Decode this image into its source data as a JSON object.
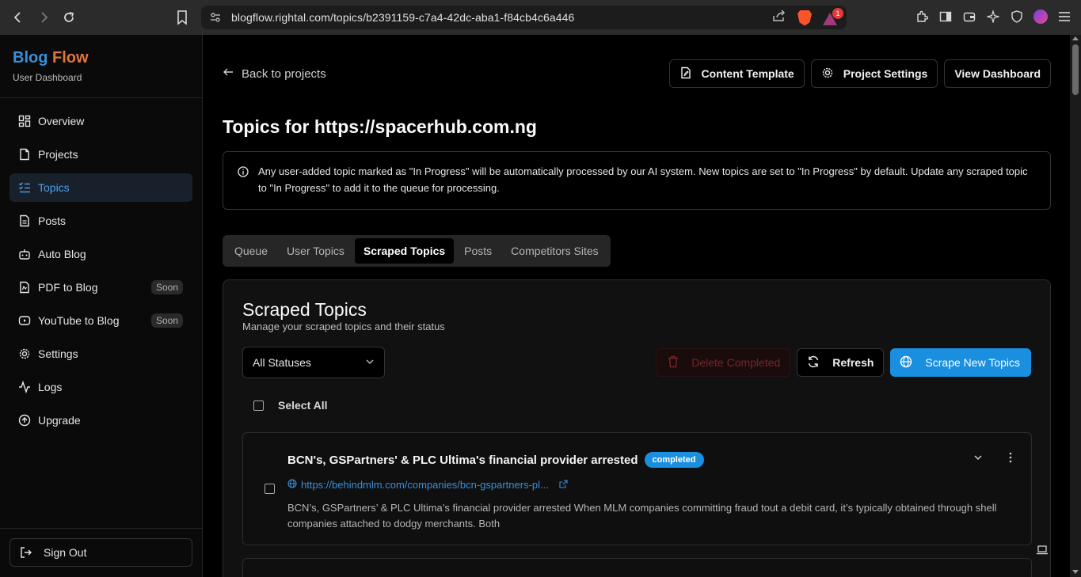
{
  "browser": {
    "url": "blogflow.rightal.com/topics/b2391159-c7a4-42dc-aba1-f84cb4c6a446",
    "notification_count": "1"
  },
  "brand": {
    "name_part1": "Blog",
    "name_part2": "Flow",
    "subtitle": "User Dashboard"
  },
  "sidebar": {
    "items": [
      {
        "label": "Overview",
        "icon": "grid-icon"
      },
      {
        "label": "Projects",
        "icon": "file-icon"
      },
      {
        "label": "Topics",
        "icon": "list-icon",
        "active": true
      },
      {
        "label": "Posts",
        "icon": "document-icon"
      },
      {
        "label": "Auto Blog",
        "icon": "bot-icon"
      },
      {
        "label": "PDF to Blog",
        "icon": "pdf-icon",
        "badge": "Soon"
      },
      {
        "label": "YouTube to Blog",
        "icon": "youtube-icon",
        "badge": "Soon"
      },
      {
        "label": "Settings",
        "icon": "gear-icon"
      },
      {
        "label": "Logs",
        "icon": "activity-icon"
      },
      {
        "label": "Upgrade",
        "icon": "upgrade-icon"
      }
    ],
    "sign_out": "Sign Out"
  },
  "header": {
    "back_label": "Back to projects",
    "content_template": "Content Template",
    "project_settings": "Project Settings",
    "view_dashboard": "View Dashboard",
    "title": "Topics for https://spacerhub.com.ng"
  },
  "info": {
    "text": "Any user-added topic marked as \"In Progress\" will be automatically processed by our AI system. New topics are set to \"In Progress\" by default. Update any scraped topic to \"In Progress\" to add it to the queue for processing."
  },
  "tabs": [
    "Queue",
    "User Topics",
    "Scraped Topics",
    "Posts",
    "Competitors Sites"
  ],
  "active_tab": "Scraped Topics",
  "scraped": {
    "title": "Scraped Topics",
    "description": "Manage your scraped topics and their status",
    "status_filter": "All Statuses",
    "delete_completed": "Delete Completed",
    "refresh": "Refresh",
    "scrape_new": "Scrape New Topics",
    "select_all": "Select All",
    "topics": [
      {
        "title": "BCN's, GSPartners' & PLC Ultima's financial provider arrested",
        "status": "completed",
        "link": "https://behindmlm.com/companies/bcn-gspartners-pl...",
        "excerpt": "BCN’s, GSPartners’ & PLC Ultima’s financial provider arrested When MLM companies committing fraud tout a debit card, it’s typically obtained through shell companies attached to dodgy merchants. Both"
      }
    ]
  },
  "colors": {
    "accent": "#1a8fdf",
    "brand_blue": "#3b8fd9",
    "brand_orange": "#e0763a",
    "danger": "#7a2424"
  }
}
